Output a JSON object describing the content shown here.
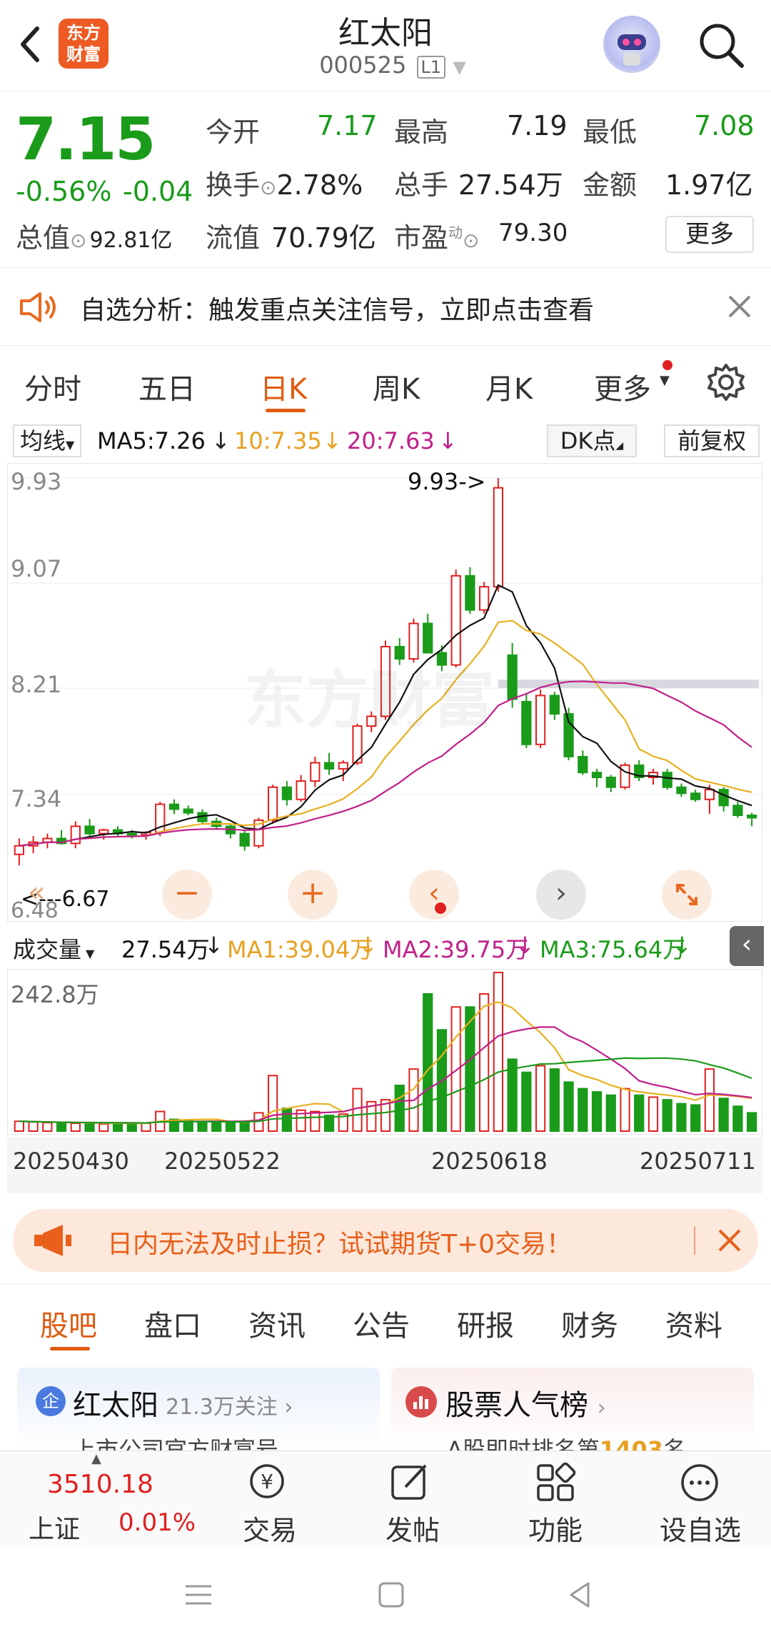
{
  "header": {
    "title": "红太阳",
    "code": "000525",
    "level": "L1",
    "logo_text_top": "东方",
    "logo_text_bottom": "财富"
  },
  "quote": {
    "price": "7.15",
    "change_pct": "-0.56%",
    "change": "-0.04",
    "open_label": "今开",
    "open": "7.17",
    "high_label": "最高",
    "high": "7.19",
    "low_label": "最低",
    "low": "7.08",
    "turnover_label": "换手",
    "turnover": "2.78%",
    "volume_label": "总手",
    "volume": "27.54万",
    "amount_label": "金额",
    "amount": "1.97亿",
    "mktcap_label": "总值",
    "mktcap": "92.81亿",
    "float_label": "流值",
    "float_cap": "70.79亿",
    "pe_label": "市盈",
    "pe_sup": "动",
    "pe": "79.30",
    "more_button": "更多"
  },
  "notice": {
    "text": "自选分析：触发重点关注信号，立即点击查看"
  },
  "chart_tabs": [
    "分时",
    "五日",
    "日K",
    "周K",
    "月K",
    "更多"
  ],
  "active_tab": "日K",
  "ma_bar": {
    "label": "均线",
    "ma5": "MA5:7.26",
    "ma10": "10:7.35",
    "ma20": "20:7.63",
    "dk": "DK点",
    "fq": "前复权"
  },
  "kline": {
    "y_labels": [
      "9.93",
      "9.07",
      "8.21",
      "7.34",
      "6.48"
    ],
    "high_note": "9.93->",
    "low_note": "<---6.67",
    "watermark": "东方财富"
  },
  "vol_bar": {
    "label": "成交量",
    "current": "27.54万",
    "ma1": "MA1:39.04万",
    "ma2": "MA2:39.75万",
    "ma3": "MA3:75.64万",
    "max_label": "242.8万"
  },
  "x_dates": [
    "20250430",
    "20250522",
    "20250618",
    "20250711"
  ],
  "chart_data": {
    "type": "candlestick",
    "ylim": [
      6.48,
      9.93
    ],
    "ohlc": [
      [
        6.85,
        6.98,
        6.76,
        6.92
      ],
      [
        6.92,
        7.0,
        6.86,
        6.95
      ],
      [
        6.95,
        7.02,
        6.9,
        6.98
      ],
      [
        6.98,
        7.05,
        6.93,
        6.94
      ],
      [
        6.94,
        7.12,
        6.9,
        7.08
      ],
      [
        7.08,
        7.14,
        7.0,
        7.02
      ],
      [
        7.02,
        7.06,
        6.97,
        7.05
      ],
      [
        7.05,
        7.08,
        7.0,
        7.02
      ],
      [
        7.02,
        7.05,
        6.98,
        7.01
      ],
      [
        7.01,
        7.04,
        6.97,
        7.03
      ],
      [
        7.03,
        7.28,
        7.0,
        7.26
      ],
      [
        7.26,
        7.3,
        7.18,
        7.22
      ],
      [
        7.22,
        7.25,
        7.17,
        7.19
      ],
      [
        7.19,
        7.22,
        7.1,
        7.12
      ],
      [
        7.12,
        7.15,
        7.05,
        7.08
      ],
      [
        7.08,
        7.1,
        6.98,
        7.02
      ],
      [
        7.02,
        7.05,
        6.88,
        6.92
      ],
      [
        6.92,
        7.15,
        6.9,
        7.13
      ],
      [
        7.13,
        7.42,
        7.1,
        7.4
      ],
      [
        7.4,
        7.45,
        7.25,
        7.3
      ],
      [
        7.3,
        7.5,
        7.28,
        7.45
      ],
      [
        7.45,
        7.65,
        7.4,
        7.6
      ],
      [
        7.6,
        7.68,
        7.5,
        7.55
      ],
      [
        7.55,
        7.62,
        7.45,
        7.6
      ],
      [
        7.6,
        7.92,
        7.58,
        7.9
      ],
      [
        7.9,
        8.02,
        7.85,
        7.98
      ],
      [
        7.98,
        8.6,
        7.95,
        8.55
      ],
      [
        8.55,
        8.62,
        8.4,
        8.45
      ],
      [
        8.45,
        8.78,
        8.42,
        8.74
      ],
      [
        8.74,
        8.82,
        8.62,
        8.5
      ],
      [
        8.5,
        8.56,
        8.35,
        8.4
      ],
      [
        8.4,
        9.18,
        8.38,
        9.13
      ],
      [
        9.13,
        9.2,
        8.82,
        8.85
      ],
      [
        8.85,
        9.08,
        8.82,
        9.04
      ],
      [
        9.04,
        9.93,
        9.0,
        9.85
      ],
      [
        8.48,
        8.58,
        8.05,
        8.12
      ],
      [
        8.1,
        8.16,
        7.72,
        7.75
      ],
      [
        7.75,
        8.2,
        7.72,
        8.15
      ],
      [
        8.15,
        8.18,
        7.95,
        8.0
      ],
      [
        8.0,
        8.05,
        7.62,
        7.65
      ],
      [
        7.65,
        7.7,
        7.5,
        7.52
      ],
      [
        7.52,
        7.55,
        7.4,
        7.48
      ],
      [
        7.48,
        7.5,
        7.36,
        7.4
      ],
      [
        7.4,
        7.6,
        7.38,
        7.58
      ],
      [
        7.58,
        7.62,
        7.45,
        7.48
      ],
      [
        7.48,
        7.55,
        7.42,
        7.52
      ],
      [
        7.52,
        7.55,
        7.38,
        7.4
      ],
      [
        7.4,
        7.43,
        7.32,
        7.35
      ],
      [
        7.35,
        7.38,
        7.28,
        7.3
      ],
      [
        7.3,
        7.42,
        7.18,
        7.38
      ],
      [
        7.38,
        7.4,
        7.2,
        7.25
      ],
      [
        7.25,
        7.28,
        7.15,
        7.17
      ],
      [
        7.17,
        7.19,
        7.08,
        7.15
      ]
    ],
    "volume": [
      15,
      14,
      13,
      12,
      12,
      13,
      11,
      12,
      11,
      12,
      30,
      18,
      16,
      14,
      13,
      12,
      14,
      28,
      85,
      35,
      32,
      30,
      24,
      26,
      65,
      45,
      48,
      70,
      95,
      210,
      155,
      190,
      190,
      210,
      242.8,
      110,
      90,
      100,
      95,
      75,
      65,
      60,
      55,
      65,
      55,
      52,
      48,
      42,
      40,
      95,
      50,
      38,
      28
    ]
  }
}
